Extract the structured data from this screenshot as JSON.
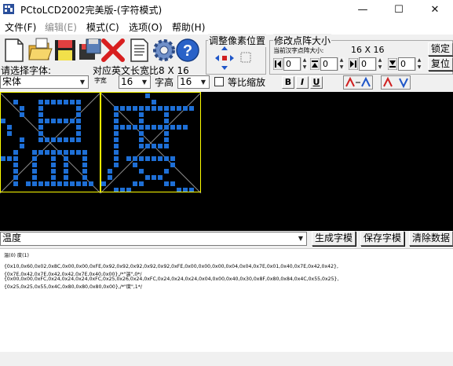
{
  "window": {
    "title": "PCtoLCD2002完美版-(字符模式)",
    "min_glyph": "—",
    "max_glyph": "☐",
    "close_glyph": "✕"
  },
  "menu": [
    {
      "label": "文件(F)",
      "disabled": false
    },
    {
      "label": "编辑(E)",
      "disabled": true
    },
    {
      "label": "模式(C)",
      "disabled": false
    },
    {
      "label": "选项(O)",
      "disabled": false
    },
    {
      "label": "帮助(H)",
      "disabled": false
    }
  ],
  "toolbar": {
    "icons": [
      "new-file-icon",
      "open-folder-icon",
      "save-disk-icon",
      "save-as-icon",
      "delete-icon",
      "document-icon",
      "settings-gear-icon",
      "help-icon"
    ],
    "font_label": "请选择字体:",
    "font_value": "宋体",
    "ratio_label": "对应英文长宽比8 X 16",
    "width_label": "字宽",
    "width_value": "16",
    "height_label": "字高",
    "height_value": "16",
    "scale_label": "等比缩放",
    "scale_checked": false,
    "format": {
      "bold": "B",
      "italic": "I",
      "underline": "U"
    }
  },
  "pixel_adjust": {
    "title": "调整像素位置"
  },
  "lattice": {
    "title": "修改点阵大小",
    "current_label": "当前汉字点阵大小:",
    "current_value": "16 X 16",
    "lock_label": "锁定",
    "reset_label": "复位",
    "spin_values": [
      "0",
      "0",
      "0",
      "0"
    ]
  },
  "chars": [
    "温",
    "度"
  ],
  "input": {
    "value": "温度",
    "generate_label": "生成字模",
    "save_label": "保存字模",
    "clear_label": "清除数据"
  },
  "output": {
    "header": "温(0) 度(1)",
    "lines": [
      "{0x10,0x60,0x02,0x8C,0x00,0x00,0xFE,0x92,0x92,0x92,0x92,0x92,0xFE,0x00,0x00,0x00,0x04,0x04,0x7E,0x01,0x40,0x7E,0x42,0x42},",
      "{0x7E,0x42,0x7E,0x42,0x42,0x7E,0x40,0x00},/*\"温\",0*/",
      "{0x00,0x00,0xFC,0x24,0x24,0x24,0xFC,0x25,0x26,0x24,0xFC,0x24,0x24,0x24,0x04,0x00,0x40,0x30,0x8F,0x80,0x84,0x4C,0x55,0x25},",
      "{0x25,0x25,0x55,0x4C,0x80,0x80,0x80,0x00},/*\"度\",1*/"
    ]
  },
  "colors": {
    "canvas_bg": "#000000",
    "dot": "#1e6fd6",
    "frame": "#ffff00",
    "diagonal": "#8a8a8a"
  }
}
